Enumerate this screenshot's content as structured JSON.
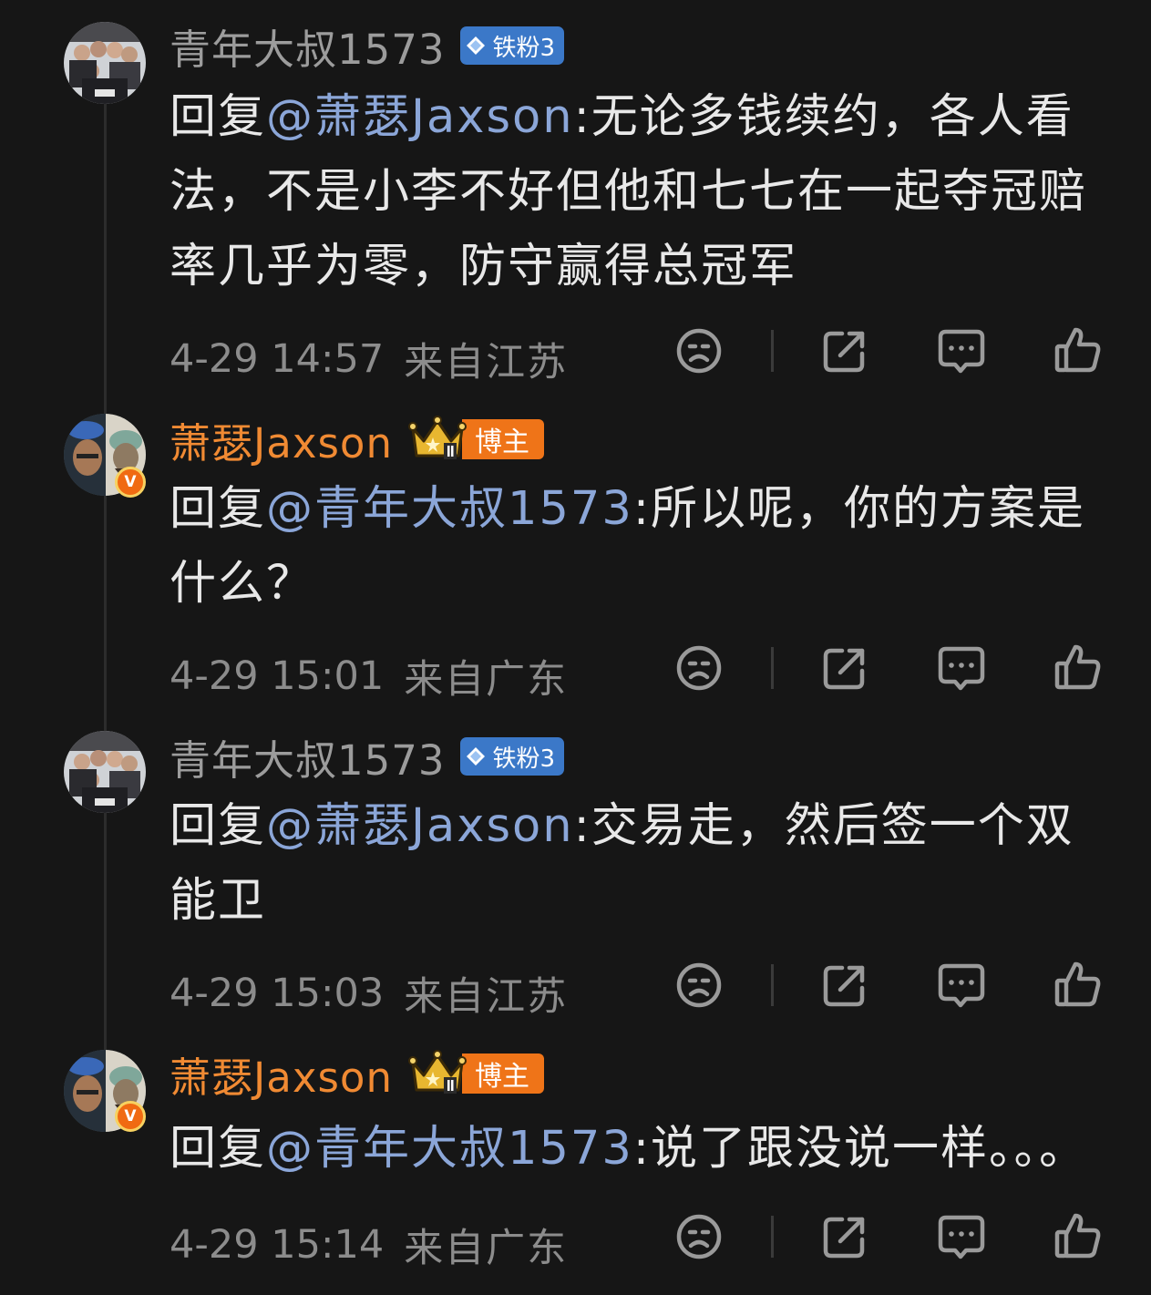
{
  "comments": [
    {
      "username": "青年大叔1573",
      "badge": "铁粉3",
      "reply_prefix": "回复",
      "mention": "@萧瑟Jaxson",
      "text": ":无论多钱续约，各人看法，不是小李不好但他和七七在一起夺冠赔率几乎为零，防守赢得总冠军",
      "timestamp": "4-29 14:57",
      "location": "来自江苏"
    },
    {
      "username": "萧瑟Jaxson",
      "badge": "博主",
      "verified_mark": "V",
      "reply_prefix": "回复",
      "mention": "@青年大叔1573",
      "text": ":所以呢，你的方案是什么？",
      "timestamp": "4-29 15:01",
      "location": "来自广东"
    },
    {
      "username": "青年大叔1573",
      "badge": "铁粉3",
      "reply_prefix": "回复",
      "mention": "@萧瑟Jaxson",
      "text": ":交易走，然后签一个双能卫",
      "timestamp": "4-29 15:03",
      "location": "来自江苏"
    },
    {
      "username": "萧瑟Jaxson",
      "badge": "博主",
      "verified_mark": "V",
      "reply_prefix": "回复",
      "mention": "@青年大叔1573",
      "text": ":说了跟没说一样。。。",
      "timestamp": "4-29 15:14",
      "location": "来自广东"
    }
  ],
  "icons": {
    "dislike": "sad-face-icon",
    "share": "share-icon",
    "reply": "comment-bubble-icon",
    "like": "thumbs-up-icon"
  },
  "colors": {
    "background": "#161616",
    "username_fan": "#9c9c9c",
    "username_blogger": "#f08a33",
    "mention": "#8ba6d8",
    "fan_badge": "#3b78c8",
    "blogger_badge": "#ef7418"
  }
}
